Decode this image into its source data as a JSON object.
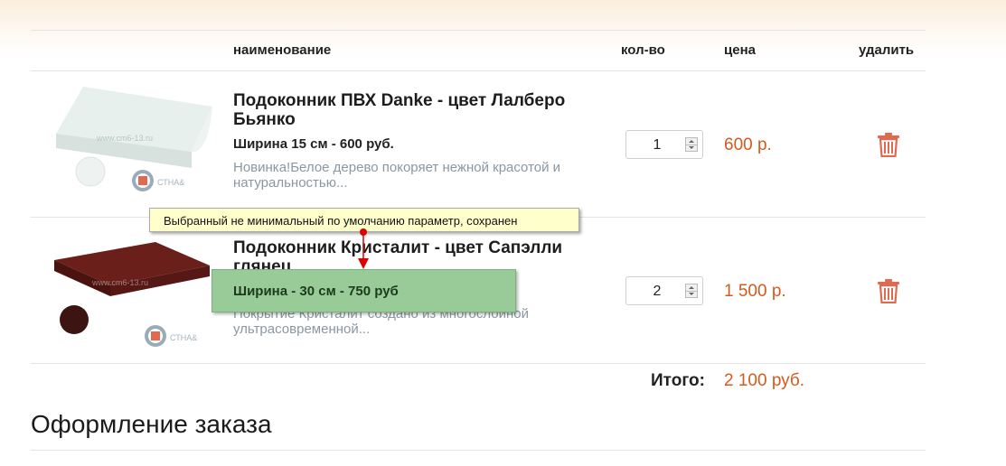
{
  "table": {
    "headers": {
      "name": "наименование",
      "qty": "кол-во",
      "price": "цена",
      "delete": "удалить"
    }
  },
  "items": [
    {
      "title": "Подоконник ПВХ Danke - цвет Лалберо Бьянко",
      "variant": "Ширина 15 см - 600 руб.",
      "description": "Новинка!Белое дерево покоряет нежной красотой и натуральностью...",
      "quantity": "1",
      "price": "600 р.",
      "watermark": "www.cm6-13.ru"
    },
    {
      "title": "Подоконник Кристалит - цвет Сапэлли глянец",
      "variant": "Ширина - 30 см - 750 руб",
      "description": "Покрытие Кристалит создано из многослойной ультрасовременной...",
      "quantity": "2",
      "price": "1 500 р.",
      "watermark": "www.cm6-13.ru"
    }
  ],
  "tooltip": {
    "text": "Выбранный не минимальный по умолчанию параметр, сохранен"
  },
  "totals": {
    "label": "Итого:",
    "value": "2 100 руб."
  },
  "checkout": {
    "heading": "Оформление заказа"
  },
  "colors": {
    "accent_price": "#d45a1e",
    "trash": "#e0694f",
    "highlight": "#98cb98",
    "tooltip_bg": "#ffffcc",
    "arrow": "#dd0000"
  },
  "icons": [
    "trash-icon",
    "badge-icon",
    "spinner-up-icon",
    "spinner-down-icon"
  ]
}
